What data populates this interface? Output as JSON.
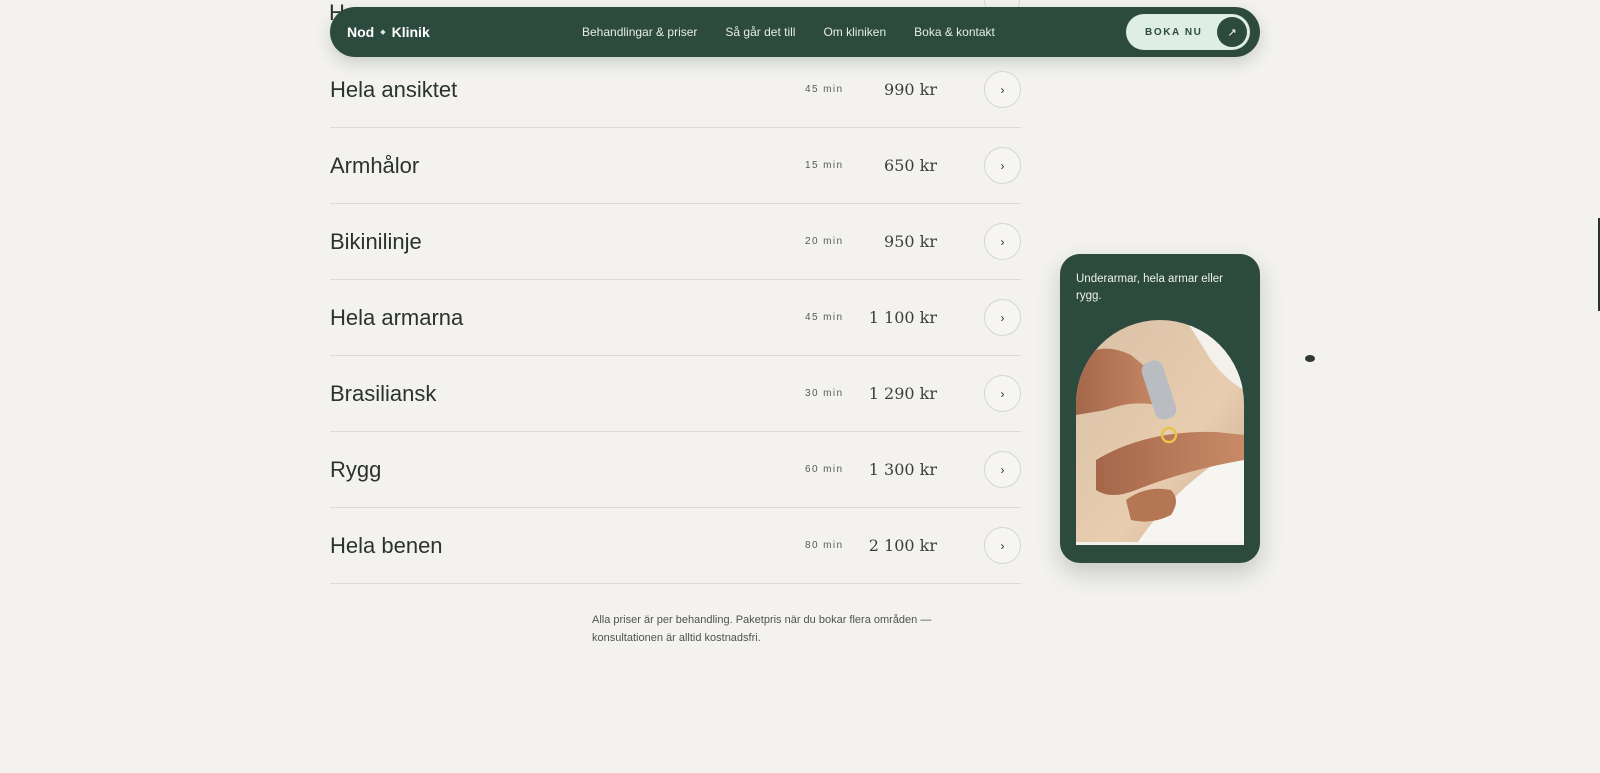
{
  "nav": {
    "brand_part1": "Nod",
    "brand_sep": "◆",
    "brand_part2": "Klinik",
    "links": [
      "Behandlingar & priser",
      "Så går det till",
      "Om kliniken",
      "Boka & kontakt"
    ],
    "cta_label": "BOKA NU",
    "cta_icon": "↗"
  },
  "hidden_row_text": "H",
  "treatments": [
    {
      "name": "Hela ansiktet",
      "duration": "45 min",
      "price": "990 kr"
    },
    {
      "name": "Armhålor",
      "duration": "15 min",
      "price": "650 kr"
    },
    {
      "name": "Bikinilinje",
      "duration": "20 min",
      "price": "950 kr"
    },
    {
      "name": "Hela armarna",
      "duration": "45 min",
      "price": "1 100 kr"
    },
    {
      "name": "Brasiliansk",
      "duration": "30 min",
      "price": "1 290 kr"
    },
    {
      "name": "Rygg",
      "duration": "60 min",
      "price": "1 300 kr"
    },
    {
      "name": "Hela benen",
      "duration": "80 min",
      "price": "2 100 kr"
    }
  ],
  "row_icon": "›",
  "footnote": "Alla priser är per behandling. Paketpris när du bokar flera områden — konsultationen är alltid kostnadsfri.",
  "card": {
    "text": "Underarmar, hela armar eller rygg."
  },
  "colors": {
    "background": "#f3f2ee",
    "brand_green": "#2d4a3e",
    "cta_background": "#dfeee5"
  }
}
